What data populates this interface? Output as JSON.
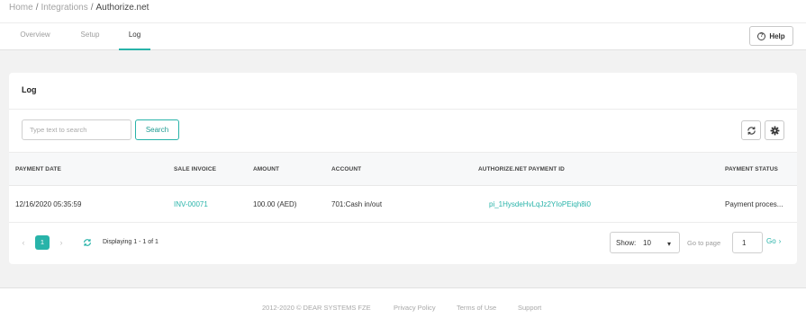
{
  "breadcrumb": {
    "home": "Home",
    "integrations": "Integrations",
    "current": "Authorize.net",
    "separator": "/"
  },
  "tabs": [
    {
      "label": "Overview"
    },
    {
      "label": "Setup"
    },
    {
      "label": "Log"
    }
  ],
  "help": {
    "label": "Help",
    "icon": "?"
  },
  "card": {
    "title": "Log",
    "search": {
      "placeholder": "Type text to search",
      "value": "",
      "button_label": "Search"
    }
  },
  "table": {
    "columns": [
      "PAYMENT DATE",
      "SALE INVOICE",
      "AMOUNT",
      "ACCOUNT",
      "AUTHORIZE.NET PAYMENT ID",
      "PAYMENT STATUS"
    ],
    "rows": [
      {
        "payment_date": "12/16/2020 05:35:59",
        "sale_invoice": "INV-00071",
        "amount": "100.00 (AED)",
        "account": "701:Cash in/out",
        "payment_id": "pi_1HysdeHvLqJz2YIoPEiqh8i0",
        "status": "Payment proces..."
      }
    ]
  },
  "pagination": {
    "prev": "‹",
    "next": "›",
    "current_page": "1",
    "display_text": "Displaying 1 - 1 of 1",
    "show_label": "Show:",
    "show_value": "10",
    "caret": "▾",
    "goto_label": "Go to page",
    "goto_value": "1",
    "go_label": "Go",
    "go_arrow": "›"
  },
  "footer": {
    "copyright": "2012-2020 © DEAR SYSTEMS FZE",
    "links": [
      "Privacy Policy",
      "Terms of Use",
      "Support"
    ]
  },
  "colors": {
    "accent": "#28b3a9",
    "background": "#f2f2f2"
  }
}
